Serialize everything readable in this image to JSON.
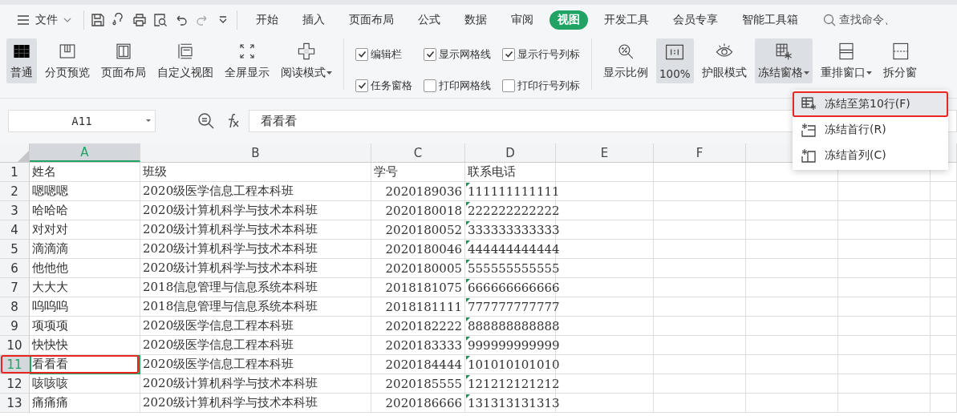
{
  "menu_bar": {
    "file_menu": "文件",
    "tabs": [
      {
        "label": "开始",
        "selected": false
      },
      {
        "label": "插入",
        "selected": false
      },
      {
        "label": "页面布局",
        "selected": false
      },
      {
        "label": "公式",
        "selected": false
      },
      {
        "label": "数据",
        "selected": false
      },
      {
        "label": "审阅",
        "selected": false
      },
      {
        "label": "视图",
        "selected": true
      },
      {
        "label": "开发工具",
        "selected": false
      },
      {
        "label": "会员专享",
        "selected": false
      },
      {
        "label": "智能工具箱",
        "selected": false
      }
    ],
    "search": {
      "placeholder": "查找命令、"
    }
  },
  "ribbon": {
    "groups": [
      {
        "kind": "buttons",
        "items": [
          {
            "label": "普通",
            "selected": true,
            "dropdown": false
          },
          {
            "label": "分页预览",
            "selected": false,
            "dropdown": false
          },
          {
            "label": "页面布局",
            "selected": false,
            "dropdown": false
          },
          {
            "label": "自定义视图",
            "selected": false,
            "dropdown": false
          },
          {
            "label": "全屏显示",
            "selected": false,
            "dropdown": false
          },
          {
            "label": "阅读模式",
            "selected": false,
            "dropdown": true
          }
        ]
      },
      {
        "kind": "checks",
        "items": [
          {
            "label": "编辑栏",
            "checked": true
          },
          {
            "label": "任务窗格",
            "checked": true
          },
          {
            "label": "显示网格线",
            "checked": true
          },
          {
            "label": "打印网格线",
            "checked": false
          },
          {
            "label": "显示行号列标",
            "checked": true
          },
          {
            "label": "打印行号列标",
            "checked": false
          }
        ]
      },
      {
        "kind": "buttons",
        "items": [
          {
            "label": "显示比例",
            "selected": false,
            "dropdown": false
          },
          {
            "label": "100%",
            "selected": true,
            "dropdown": false
          },
          {
            "label": "护眼模式",
            "selected": false,
            "dropdown": false
          },
          {
            "label": "冻结窗格",
            "selected": true,
            "dropdown": true
          },
          {
            "label": "重排窗口",
            "selected": false,
            "dropdown": true
          },
          {
            "label": "拆分窗",
            "selected": false,
            "dropdown": false
          }
        ]
      }
    ]
  },
  "freeze_menu": {
    "items": [
      {
        "label": "冻结至第10行(F)",
        "selected": true,
        "marked": true
      },
      {
        "label": "冻结首行(R)",
        "selected": false,
        "marked": false
      },
      {
        "label": "冻结首列(C)",
        "selected": false,
        "marked": false
      }
    ]
  },
  "formula_bar": {
    "name_box": "A11",
    "formula": "看看看"
  },
  "sheet": {
    "columns": [
      {
        "label": "A",
        "selected": true
      },
      {
        "label": "B",
        "selected": false
      },
      {
        "label": "C",
        "selected": false
      },
      {
        "label": "D",
        "selected": false
      },
      {
        "label": "E",
        "selected": false
      },
      {
        "label": "F",
        "selected": false
      }
    ],
    "rows": [
      {
        "number": "1",
        "selected": false,
        "marked": false,
        "cells": [
          "姓名",
          "班级",
          "学号",
          "联系电话"
        ]
      },
      {
        "number": "2",
        "selected": false,
        "marked": false,
        "cells": [
          "嗯嗯嗯",
          "2020级医学信息工程本科班",
          "2020189036",
          "111111111111"
        ]
      },
      {
        "number": "3",
        "selected": false,
        "marked": false,
        "cells": [
          "哈哈哈",
          "2020级计算机科学与技术本科班",
          "2020180018",
          "222222222222"
        ]
      },
      {
        "number": "4",
        "selected": false,
        "marked": false,
        "cells": [
          "对对对",
          "2020级计算机科学与技术本科班",
          "2020180052",
          "333333333333"
        ]
      },
      {
        "number": "5",
        "selected": false,
        "marked": false,
        "cells": [
          "滴滴滴",
          "2020级计算机科学与技术本科班",
          "2020180046",
          "444444444444"
        ]
      },
      {
        "number": "6",
        "selected": false,
        "marked": false,
        "cells": [
          "他他他",
          "2020级计算机科学与技术本科班",
          "2020180005",
          "555555555555"
        ]
      },
      {
        "number": "7",
        "selected": false,
        "marked": false,
        "cells": [
          "大大大",
          "2018信息管理与信息系统本科班",
          "2018181075",
          "666666666666"
        ]
      },
      {
        "number": "8",
        "selected": false,
        "marked": false,
        "cells": [
          "呜呜呜",
          "2018信息管理与信息系统本科班",
          "2018181111",
          "777777777777"
        ]
      },
      {
        "number": "9",
        "selected": false,
        "marked": false,
        "cells": [
          "项项项",
          "2020级医学信息工程本科班",
          "2020182222",
          "888888888888"
        ]
      },
      {
        "number": "10",
        "selected": false,
        "marked": false,
        "cells": [
          "快快快",
          "2020级医学信息工程本科班",
          "2020183333",
          "999999999999"
        ]
      },
      {
        "number": "11",
        "selected": true,
        "marked": true,
        "cells": [
          "看看看",
          "2020级医学信息工程本科班",
          "2020184444",
          "101010101010"
        ]
      },
      {
        "number": "12",
        "selected": false,
        "marked": false,
        "cells": [
          "咳咳咳",
          "2020级计算机科学与技术本科班",
          "2020185555",
          "121212121212"
        ]
      },
      {
        "number": "13",
        "selected": false,
        "marked": false,
        "cells": [
          "痛痛痛",
          "2020级计算机科学与技术本科班",
          "2020186666",
          "131313131313"
        ]
      }
    ]
  }
}
